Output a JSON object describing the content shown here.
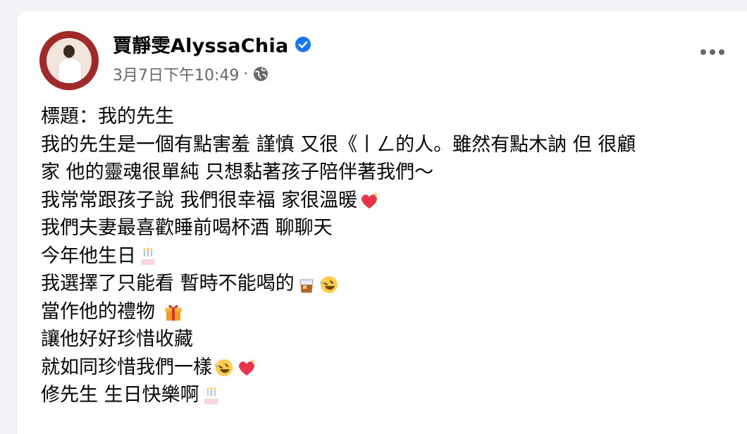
{
  "post": {
    "author": "賈靜雯AlyssaChia",
    "timestamp": "3月7日下午10:49",
    "separator": "·",
    "privacy_icon": "globe-icon",
    "verified_icon": "verified-badge-icon",
    "more_icon": "more-options-icon",
    "colors": {
      "verified": "#1877f2",
      "secondary_text": "#65676b",
      "avatar_ring": "#a02a2a"
    },
    "lines": [
      {
        "text": "標題：我的先生",
        "emoji": []
      },
      {
        "text": "我的先生是一個有點害羞 謹慎 又很《丨ㄥ的人。雖然有點木訥 但 很顧",
        "emoji": []
      },
      {
        "text": "家 他的靈魂很單純 只想黏著孩子陪伴著我們～",
        "emoji": []
      },
      {
        "text": "我常常跟孩子說 我們很幸福 家很溫暖",
        "emoji": [
          "sparkling-heart"
        ]
      },
      {
        "text": "我們夫妻最喜歡睡前喝杯酒 聊聊天",
        "emoji": []
      },
      {
        "text": "今年他生日",
        "emoji": [
          "birthday-cake"
        ]
      },
      {
        "text": "我選擇了只能看 暫時不能喝的",
        "emoji": [
          "whisky-glass",
          "rofl"
        ]
      },
      {
        "text": "當作他的禮物 ",
        "emoji": [
          "gift"
        ]
      },
      {
        "text": "讓他好好珍惜收藏",
        "emoji": []
      },
      {
        "text": "就如同珍惜我們一樣",
        "emoji": [
          "rofl",
          "sparkling-heart"
        ]
      },
      {
        "text": "修先生 生日快樂啊",
        "emoji": [
          "birthday-cake"
        ]
      }
    ]
  }
}
